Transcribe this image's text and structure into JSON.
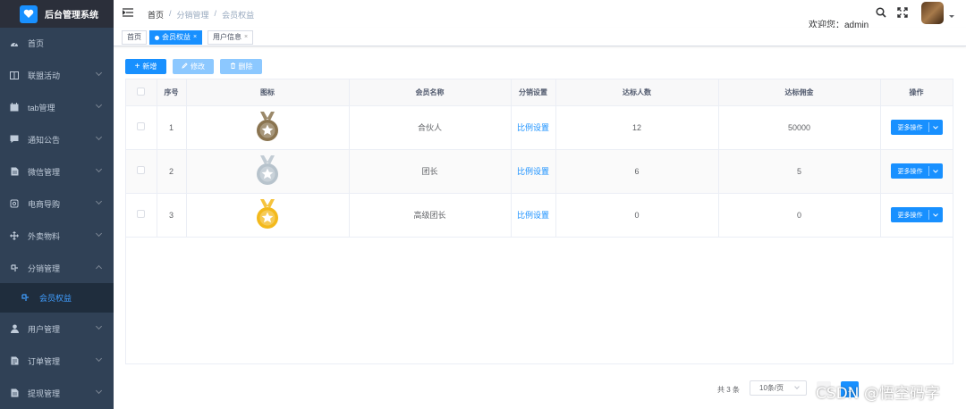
{
  "app": {
    "title": "后台管理系统"
  },
  "sidebar": {
    "items": [
      {
        "label": "首页",
        "icon": "dashboard-icon",
        "has_arrow": false
      },
      {
        "label": "联盟活动",
        "icon": "book-icon",
        "has_arrow": true
      },
      {
        "label": "tab管理",
        "icon": "calendar-icon",
        "has_arrow": true
      },
      {
        "label": "通知公告",
        "icon": "message-icon",
        "has_arrow": true
      },
      {
        "label": "微信管理",
        "icon": "document-icon",
        "has_arrow": true
      },
      {
        "label": "电商导购",
        "icon": "shopping-icon",
        "has_arrow": true
      },
      {
        "label": "外卖物料",
        "icon": "move-icon",
        "has_arrow": true
      },
      {
        "label": "分销管理",
        "icon": "share-icon",
        "has_arrow": true,
        "expanded": true
      },
      {
        "label": "用户管理",
        "icon": "user-icon",
        "has_arrow": true
      },
      {
        "label": "订单管理",
        "icon": "order-icon",
        "has_arrow": true
      },
      {
        "label": "提现管理",
        "icon": "withdraw-icon",
        "has_arrow": true
      }
    ],
    "sub_item": {
      "label": "会员权益",
      "icon": "share-icon"
    }
  },
  "header": {
    "breadcrumb": [
      "首页",
      "分销管理",
      "会员权益"
    ],
    "breadcrumb_sep": "/",
    "welcome": "欢迎您：admin"
  },
  "tags": [
    {
      "label": "首页",
      "active": false
    },
    {
      "label": "会员权益",
      "active": true
    },
    {
      "label": "用户信息",
      "active": false
    }
  ],
  "tag_close": "×",
  "toolbar": {
    "add_label": "新增",
    "edit_label": "修改",
    "delete_label": "删除"
  },
  "table": {
    "headers": [
      "序号",
      "图标",
      "会员名称",
      "分销设置",
      "达标人数",
      "达标佣金",
      "操作"
    ],
    "rows": [
      {
        "index": "1",
        "medal_color": "#8a7450",
        "name": "合伙人",
        "setting": "比例设置",
        "people": "12",
        "commission": "50000",
        "action": "更多操作"
      },
      {
        "index": "2",
        "medal_color": "#b7c3cc",
        "name": "团长",
        "setting": "比例设置",
        "people": "6",
        "commission": "5",
        "action": "更多操作"
      },
      {
        "index": "3",
        "medal_color": "#f3b91c",
        "name": "高级团长",
        "setting": "比例设置",
        "people": "0",
        "commission": "0",
        "action": "更多操作"
      }
    ]
  },
  "pagination": {
    "total": "共 3 条",
    "page_size": "10条/页",
    "current_page": "1"
  },
  "watermark": "CSDN @悟空码字",
  "colors": {
    "primary": "#1890ff",
    "sidebar_bg": "#304156",
    "sidebar_active": "#409eff"
  }
}
